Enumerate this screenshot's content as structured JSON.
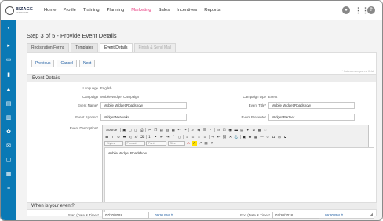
{
  "brand": {
    "name": "BIZAGE",
    "tagline": "NETWORKS"
  },
  "nav": [
    "Home",
    "Profile",
    "Training",
    "Planning",
    "Marketing",
    "Sales",
    "Incentives",
    "Reports"
  ],
  "nav_active": "Marketing",
  "page": {
    "step_title": "Step 3 of 5 - Provide Event Details"
  },
  "tabs": [
    "Registration Forms",
    "Templates",
    "Event Details",
    "Finish & Send Mail"
  ],
  "buttons": {
    "previous": "Previous",
    "cancel": "Cancel",
    "next": "Next"
  },
  "required_note": "* Indicates required field",
  "event_details": {
    "heading": "Event Details",
    "language_label": "Language",
    "language_value": "English",
    "campaign_label": "Campaign",
    "campaign_value": "Mobile Widget Campaign",
    "campaign_type_label": "Campaign type",
    "campaign_type_value": "Event",
    "event_name_label": "Event Name*",
    "event_name_value": "Mobile Widget Roadshow",
    "event_title_label": "Event Title*",
    "event_title_value": "Mobile Widget Roadshow",
    "event_sponsor_label": "Event Sponsor",
    "event_sponsor_value": "Widget Networks",
    "event_presenter_label": "Event Presenter",
    "event_presenter_value": "Widget Partner",
    "event_description_label": "Event Description*",
    "editor_text": "Mobile Widget Roadshow",
    "editor_source": "Source",
    "editor_styles": "Styles",
    "editor_format": "Format",
    "editor_font": "Font",
    "editor_size": "Size"
  },
  "when": {
    "heading": "When is your event?",
    "start_label": "Start (Date & Time)*",
    "start_date": "07/20/2018",
    "start_time": "09:30 PM",
    "end_label": "End (Date & Time)*",
    "end_date": "07/20/2018",
    "end_time": "09:30 PM"
  }
}
